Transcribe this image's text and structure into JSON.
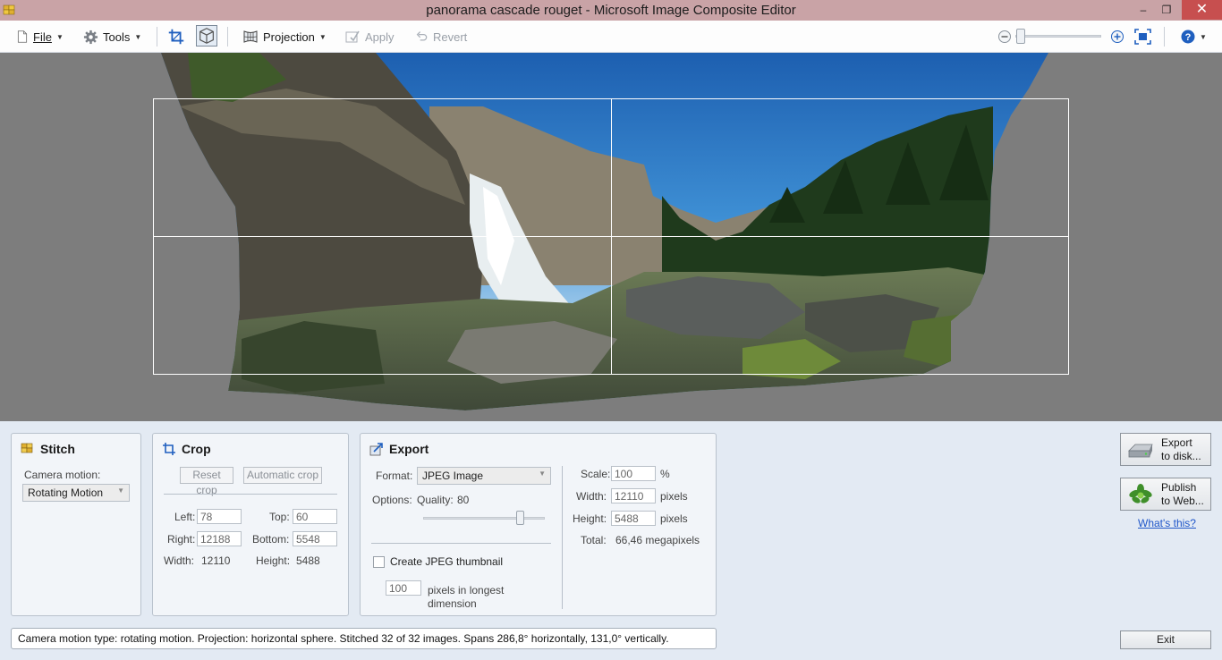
{
  "window": {
    "title": "panorama cascade rouget - Microsoft Image Composite Editor",
    "minimize": "–",
    "restore": "❐",
    "close": "✕"
  },
  "toolbar": {
    "file_label": "File",
    "tools_label": "Tools",
    "projection_label": "Projection",
    "apply_label": "Apply",
    "revert_label": "Revert",
    "zoom_level": 0.0
  },
  "stitch": {
    "title": "Stitch",
    "camera_motion_label": "Camera motion:",
    "camera_motion_value": "Rotating Motion"
  },
  "crop": {
    "title": "Crop",
    "reset_label": "Reset crop",
    "auto_label": "Automatic crop",
    "left_label": "Left:",
    "left_value": "78",
    "top_label": "Top:",
    "top_value": "60",
    "right_label": "Right:",
    "right_value": "12188",
    "bottom_label": "Bottom:",
    "bottom_value": "5548",
    "width_label": "Width:",
    "width_value": "12110",
    "height_label": "Height:",
    "height_value": "5488"
  },
  "export": {
    "title": "Export",
    "format_label": "Format:",
    "format_value": "JPEG Image",
    "options_label": "Options:",
    "quality_label": "Quality:",
    "quality_value": "80",
    "quality_fraction": 0.8,
    "thumbnail_label": "Create JPEG thumbnail",
    "thumbnail_checked": false,
    "thumb_pixels_value": "100",
    "thumb_pixels_label": "pixels in longest",
    "thumb_pixels_label2": "dimension",
    "scale_label": "Scale:",
    "scale_value": "100",
    "scale_unit": "%",
    "width_label": "Width:",
    "width_value": "12110",
    "width_unit": "pixels",
    "height_label": "Height:",
    "height_value": "5488",
    "height_unit": "pixels",
    "total_label": "Total:",
    "total_value": "66,46 megapixels"
  },
  "actions": {
    "export_disk_line1": "Export",
    "export_disk_line2": "to disk...",
    "publish_line1": "Publish",
    "publish_line2": "to Web...",
    "whats_this": "What's this?",
    "exit_label": "Exit"
  },
  "status": {
    "text": "Camera motion type: rotating motion. Projection: horizontal sphere. Stitched 32 of 32 images. Spans 286,8° horizontally, 131,0° vertically."
  },
  "colors": {
    "titlebar": "#c9a3a6",
    "canvas_bg": "#7d7d7d",
    "link": "#1f56c9"
  }
}
